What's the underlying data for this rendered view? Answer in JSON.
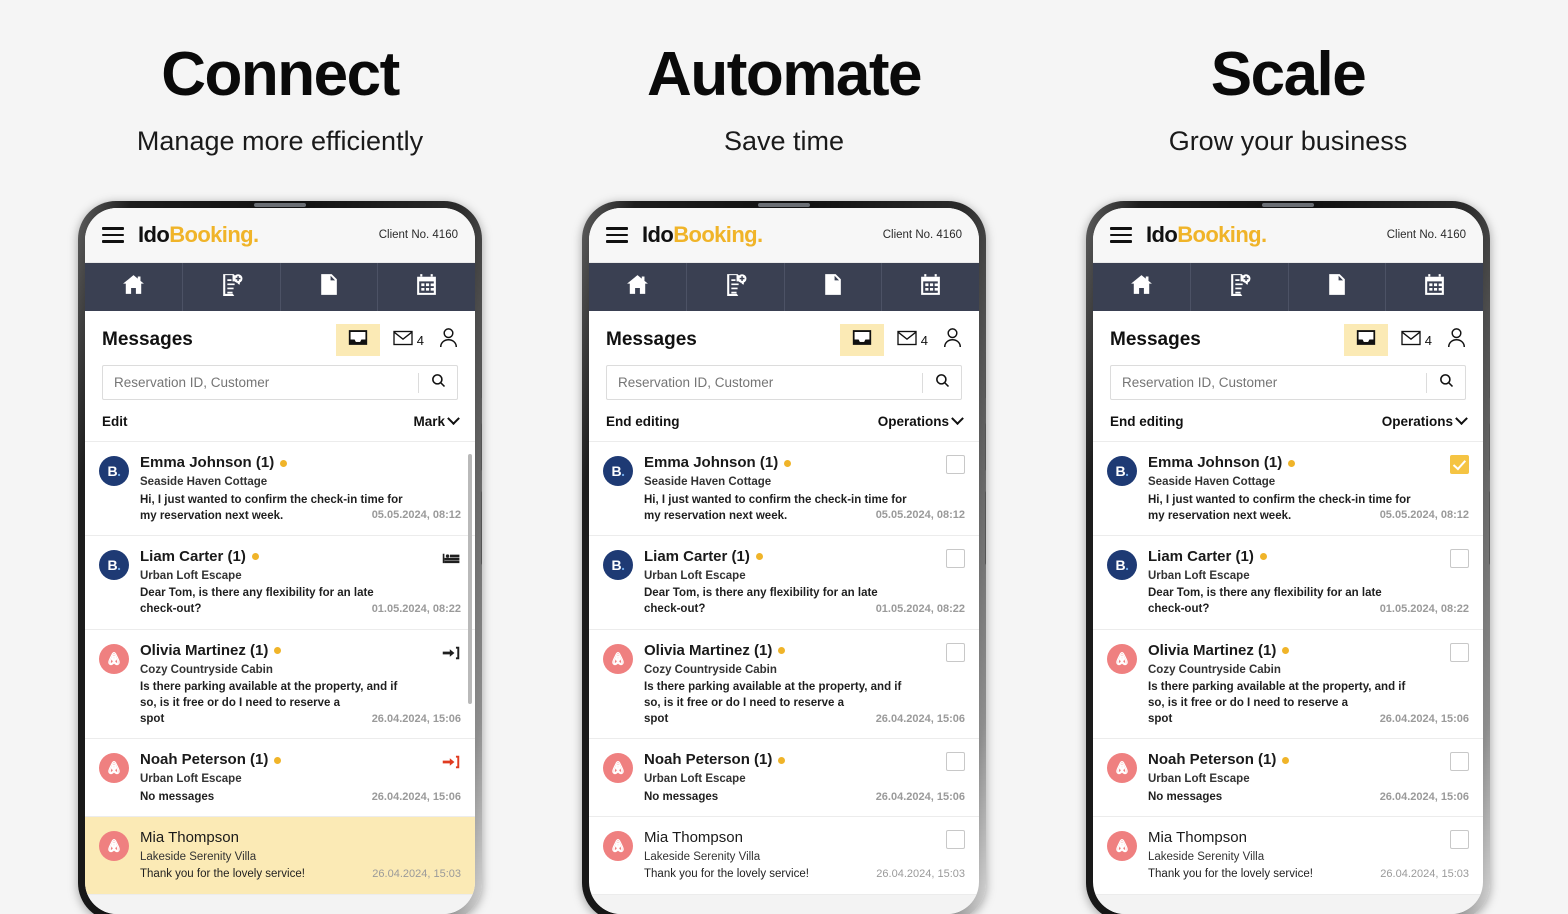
{
  "columns": [
    {
      "heading": "Connect",
      "subheading": "Manage more efficiently",
      "mode": "edit"
    },
    {
      "heading": "Automate",
      "subheading": "Save time",
      "mode": "editing"
    },
    {
      "heading": "Scale",
      "subheading": "Grow your business",
      "mode": "editing"
    }
  ],
  "app": {
    "brand": {
      "part1": "Ido",
      "part2": "Booking",
      "dot": "."
    },
    "client_no": "Client No. 4160",
    "nav": [
      {
        "icon": "home-icon",
        "label": "Home"
      },
      {
        "icon": "document-add-icon",
        "label": "New document"
      },
      {
        "icon": "document-icon",
        "label": "Documents"
      },
      {
        "icon": "calendar-icon",
        "label": "Calendar"
      }
    ],
    "messages_title": "Messages",
    "tray_icon": "inbox-tray-icon",
    "mail_icon": "envelope-icon",
    "mail_count": "4",
    "person_icon": "person-icon",
    "search": {
      "placeholder": "Reservation ID, Customer",
      "value": "",
      "icon": "search-icon"
    },
    "toolbar_edit": {
      "left_label": "Edit",
      "right_label": "Mark"
    },
    "toolbar_editing": {
      "left_label": "End editing",
      "right_label": "Operations"
    },
    "colors": {
      "accent_yellow": "#f0b429",
      "highlight_yellow": "#fbeab5",
      "checkbox_yellow": "#f5c443",
      "navbar_dark": "#3a4052",
      "booking_blue": "#1e3a74",
      "airbnb_salmon": "#ef8080",
      "red_arrow": "#e03b20"
    }
  },
  "messages": [
    {
      "avatar": "booking",
      "avatar_label": "booking-logo",
      "name": "Emma Johnson (1)",
      "unread": true,
      "property": "Seaside Haven Cottage",
      "preview_line1": "Hi, I just wanted to confirm the check-in time for",
      "preview_line2": "my reservation next week.",
      "time": "05.05.2024, 08:12",
      "row_icon": "",
      "checked": true
    },
    {
      "avatar": "booking",
      "avatar_label": "booking-logo",
      "name": "Liam Carter (1)",
      "unread": true,
      "property": "Urban Loft Escape",
      "preview_line1": "Dear Tom, is there any flexibility for an late",
      "preview_line2": "check-out?",
      "time": "01.05.2024, 08:22",
      "row_icon": "bed-icon",
      "checked": false
    },
    {
      "avatar": "airbnb",
      "avatar_label": "airbnb-logo",
      "name": "Olivia Martinez (1)",
      "unread": true,
      "property": "Cozy Countryside Cabin",
      "preview_line1": "Is there parking available at the property, and if",
      "preview_line2": "so, is it free or do I need to reserve a spot",
      "time": "26.04.2024, 15:06",
      "row_icon": "check-in-arrow-icon",
      "checked": false
    },
    {
      "avatar": "airbnb",
      "avatar_label": "airbnb-logo",
      "name": "Noah Peterson (1)",
      "unread": true,
      "property": "Urban Loft Escape",
      "preview_line1": "No messages",
      "preview_line2": "",
      "time": "26.04.2024, 15:06",
      "row_icon": "check-in-arrow-red-icon",
      "checked": false
    },
    {
      "avatar": "airbnb",
      "avatar_label": "airbnb-logo",
      "name": "Mia Thompson",
      "unread": false,
      "property": "Lakeside Serenity Villa",
      "preview_line1": "Thank you for the lovely service!",
      "preview_line2": "",
      "time": "26.04.2024, 15:03",
      "row_icon": "",
      "checked": false
    }
  ]
}
